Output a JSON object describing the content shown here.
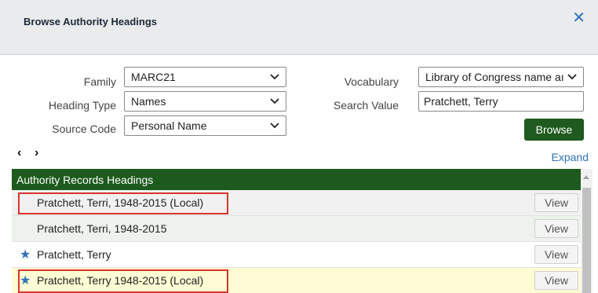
{
  "dialog": {
    "title": "Browse Authority Headings"
  },
  "form": {
    "family": {
      "label": "Family",
      "value": "MARC21"
    },
    "heading_type": {
      "label": "Heading Type",
      "value": "Names"
    },
    "source_code": {
      "label": "Source Code",
      "value": "Personal Name"
    },
    "vocabulary": {
      "label": "Vocabulary",
      "value": "Library of Congress name aı"
    },
    "search_value": {
      "label": "Search Value",
      "value": "Pratchett, Terry"
    },
    "browse_label": "Browse"
  },
  "pager": {
    "prev": "‹",
    "next": "›",
    "expand_label": "Expand"
  },
  "table": {
    "header": "Authority Records Headings",
    "rows": [
      {
        "heading": "Pratchett, Terri, 1948-2015 (Local)",
        "starred": false,
        "bg": "#f1f1f1",
        "view_label": "View"
      },
      {
        "heading": "Pratchett, Terri, 1948-2015",
        "starred": false,
        "bg": "#edf3ec",
        "view_label": "View"
      },
      {
        "heading": "Pratchett, Terry",
        "starred": true,
        "bg": "#ffffff",
        "view_label": "View"
      },
      {
        "heading": "Pratchett, Terry 1948-2015 (Local)",
        "starred": true,
        "bg": "#fdfcd4",
        "view_label": "View"
      }
    ]
  },
  "colors": {
    "header_green": "#1d5a1d",
    "browse_green": "#1f5a1f",
    "link_blue": "#2e73b8",
    "highlight_red": "#d9342b"
  },
  "icons": {
    "close": "close-icon",
    "star": "star-icon",
    "chevron": "chevron-down-icon"
  }
}
